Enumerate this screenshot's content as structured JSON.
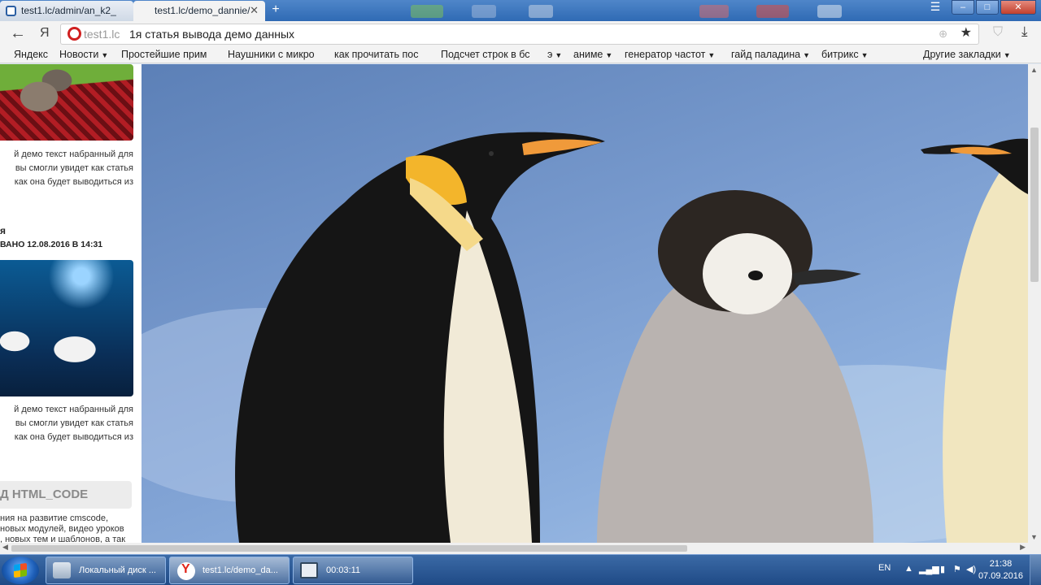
{
  "tabs": [
    {
      "label": "test1.lc/admin/an_k2_",
      "active": false
    },
    {
      "label": "test1.lc/demo_dannie/",
      "active": true
    }
  ],
  "address": {
    "host": "test1.lc",
    "page_title": "1я статья вывода демо данных"
  },
  "toolbar": {
    "back_symbol": "←",
    "yandex_symbol": "Я"
  },
  "bookmarks": [
    {
      "label": "Яндекс",
      "dropdown": false
    },
    {
      "label": "Новости",
      "dropdown": true
    },
    {
      "label": "Простейшие прим",
      "dropdown": false
    },
    {
      "label": "Наушники с микро",
      "dropdown": false
    },
    {
      "label": "как прочитать пос",
      "dropdown": false
    },
    {
      "label": "Подсчет строк в бс",
      "dropdown": false
    },
    {
      "label": "э",
      "dropdown": true
    },
    {
      "label": "аниме",
      "dropdown": true
    },
    {
      "label": "генератор частот",
      "dropdown": true
    },
    {
      "label": "гайд паладина",
      "dropdown": true
    },
    {
      "label": "битрикс",
      "dropdown": true
    },
    {
      "label": "Другие закладки",
      "dropdown": true
    }
  ],
  "sidebar": {
    "text_block_1": [
      "й демо текст набранный для",
      "вы смогли увидет как статья",
      "как она будет выводиться из"
    ],
    "heading": "я",
    "date": "ВАНО 12.08.2016 В 14:31",
    "text_block_2": [
      "й демо текст набранный для",
      "вы смогли увидет как статья",
      "как она будет выводиться из"
    ],
    "box_title": "Д HTML_CODE",
    "small_text": [
      "ния на развитие cmscode,",
      "новых модулей, видео уроков",
      ", новых тем и шаблонов, а так"
    ]
  },
  "taskbar": {
    "items": [
      {
        "label": "Локальный диск ..."
      },
      {
        "label": "test1.lc/demo_da..."
      },
      {
        "label": "00:03:11"
      }
    ],
    "lang": "EN",
    "time": "21:38",
    "date": "07.09.2016"
  }
}
